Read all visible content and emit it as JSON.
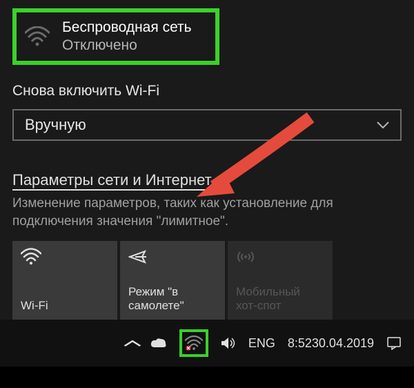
{
  "wifi": {
    "name": "Беспроводная сеть",
    "status": "Отключено"
  },
  "reenable": {
    "title": "Снова включить Wi-Fi",
    "selected": "Вручную"
  },
  "settings": {
    "link": "Параметры сети и Интернет",
    "desc": "Изменение параметров, таких как установление для подключения значения \"лимитное\"."
  },
  "tiles": {
    "wifi": "Wi-Fi",
    "airplane": "Режим \"в самолете\"",
    "hotspot": "Мобильный хот-спот"
  },
  "tray": {
    "lang": "ENG",
    "time": "8:52",
    "date": "30.04.2019"
  },
  "icons": {
    "wifi": "wifi-icon",
    "airplane": "airplane-icon",
    "hotspot": "hotspot-icon",
    "chevron_down": "chevron-down-icon",
    "chevron_up": "chevron-up-icon",
    "cloud": "cloud-icon",
    "speaker": "speaker-icon",
    "notification": "notification-icon"
  },
  "colors": {
    "highlight": "#3bd12a",
    "arrow": "#e54b3c"
  }
}
